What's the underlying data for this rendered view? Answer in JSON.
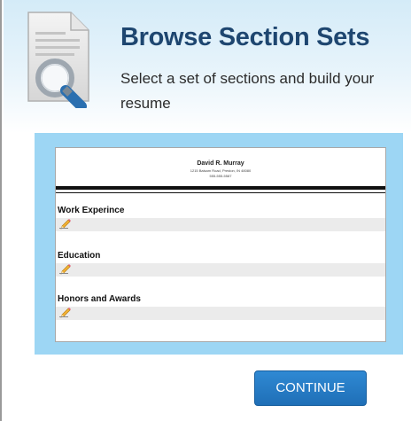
{
  "header": {
    "title": "Browse Section Sets",
    "subtitle": "Select a set of sections and build your resume",
    "icon": "document-search-icon"
  },
  "resume": {
    "name": "David R. Murray",
    "address": "1215 Balsam Road, Preston, IN 48080",
    "phone": "555-555-5587",
    "sections": [
      {
        "label": "Work Experince"
      },
      {
        "label": "Education"
      },
      {
        "label": "Honors and Awards"
      }
    ]
  },
  "actions": {
    "continue_label": "CONTINUE"
  },
  "colors": {
    "title": "#1e4670",
    "preview_frame": "#9dd6f4",
    "button": "#1f6fb7"
  }
}
